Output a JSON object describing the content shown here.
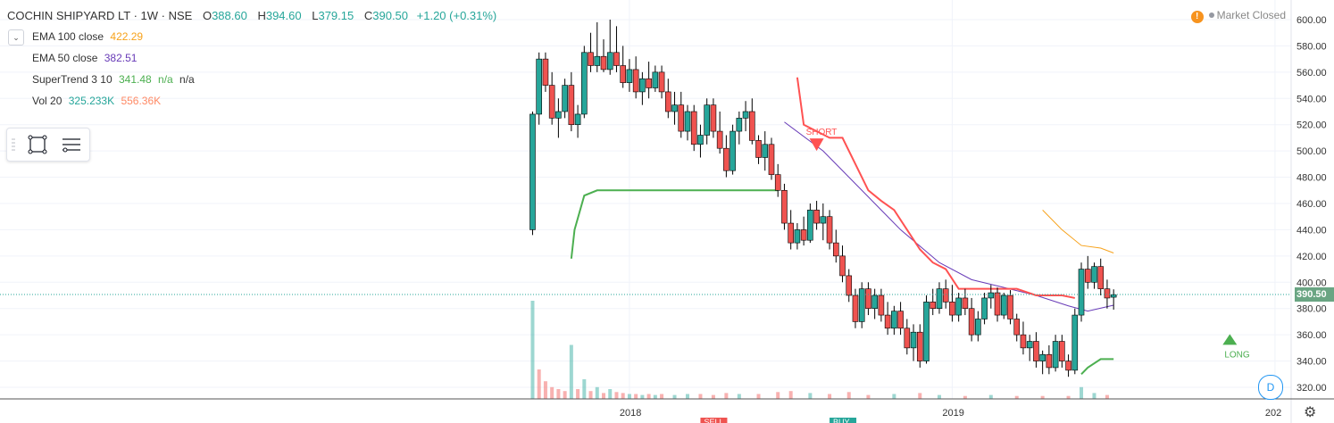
{
  "header": {
    "symbol_title": "COCHIN SHIPYARD LT · 1W · NSE",
    "open_label": "O",
    "open": "388.60",
    "high_label": "H",
    "high": "394.60",
    "low_label": "L",
    "low": "379.15",
    "close_label": "C",
    "close": "390.50",
    "change": "+1.20 (+0.31%)"
  },
  "indicators": [
    {
      "label": "EMA 100 close",
      "values": [
        "422.29"
      ],
      "colors": [
        "#f7a21b"
      ]
    },
    {
      "label": "EMA 50 close",
      "values": [
        "382.51"
      ],
      "colors": [
        "#673ab7"
      ]
    },
    {
      "label": "SuperTrend 3 10",
      "values": [
        "341.48",
        "n/a",
        "n/a"
      ],
      "colors": [
        "#4caf50",
        "#4caf50",
        "#333333"
      ]
    },
    {
      "label": "Vol 20",
      "values": [
        "325.233K",
        "556.36K"
      ],
      "colors": [
        "#26a69a",
        "#ff8a65"
      ]
    }
  ],
  "market_status": {
    "icon": "!",
    "text": "Market Closed"
  },
  "badge": {
    "label": "D"
  },
  "last_price_label": "390.50",
  "icons": {
    "collapse": "chevron-down-icon",
    "rectangle_tool": "rectangle-icon",
    "menu": "hamburger-icon",
    "settings": "gear-icon"
  },
  "colors": {
    "up": "#26a69a",
    "down": "#ef5350",
    "ema100": "#f7a21b",
    "ema50": "#673ab7",
    "supertrend_up": "#4caf50",
    "supertrend_down": "#ff5252",
    "last_price_line": "#26a69a"
  },
  "chart_data": {
    "type": "candlestick",
    "y_ticks": [
      "600.00",
      "580.00",
      "560.00",
      "540.00",
      "520.00",
      "500.00",
      "480.00",
      "460.00",
      "440.00",
      "420.00",
      "400.00",
      "380.00",
      "360.00",
      "340.00",
      "320.00"
    ],
    "ylim": [
      320,
      600
    ],
    "x_ticks": [
      "2018",
      "2019",
      "202"
    ],
    "x_tick_positions": [
      2018.0,
      2019.0,
      2020.0
    ],
    "xlim": [
      2016.05,
      2020.05
    ],
    "signals": [
      {
        "text": "SHORT",
        "x": 2018.58,
        "y": 515
      },
      {
        "text": "LONG",
        "x": 2019.86,
        "y": 351
      }
    ],
    "markers": [
      "BUY",
      "SELL"
    ],
    "candles": [
      {
        "t": 2017.7,
        "o": 440,
        "h": 530,
        "l": 436,
        "c": 528
      },
      {
        "t": 2017.72,
        "o": 528,
        "h": 575,
        "l": 520,
        "c": 570
      },
      {
        "t": 2017.74,
        "o": 570,
        "h": 575,
        "l": 545,
        "c": 550
      },
      {
        "t": 2017.76,
        "o": 550,
        "h": 560,
        "l": 520,
        "c": 525
      },
      {
        "t": 2017.78,
        "o": 525,
        "h": 540,
        "l": 510,
        "c": 530
      },
      {
        "t": 2017.8,
        "o": 530,
        "h": 555,
        "l": 525,
        "c": 550
      },
      {
        "t": 2017.82,
        "o": 550,
        "h": 560,
        "l": 515,
        "c": 520
      },
      {
        "t": 2017.84,
        "o": 520,
        "h": 535,
        "l": 510,
        "c": 528
      },
      {
        "t": 2017.86,
        "o": 528,
        "h": 580,
        "l": 525,
        "c": 575
      },
      {
        "t": 2017.88,
        "o": 575,
        "h": 590,
        "l": 560,
        "c": 565
      },
      {
        "t": 2017.9,
        "o": 565,
        "h": 598,
        "l": 560,
        "c": 572
      },
      {
        "t": 2017.92,
        "o": 572,
        "h": 585,
        "l": 560,
        "c": 562
      },
      {
        "t": 2017.94,
        "o": 562,
        "h": 600,
        "l": 558,
        "c": 575
      },
      {
        "t": 2017.96,
        "o": 575,
        "h": 595,
        "l": 560,
        "c": 565
      },
      {
        "t": 2017.98,
        "o": 565,
        "h": 580,
        "l": 548,
        "c": 552
      },
      {
        "t": 2018.0,
        "o": 552,
        "h": 570,
        "l": 545,
        "c": 562
      },
      {
        "t": 2018.02,
        "o": 562,
        "h": 572,
        "l": 540,
        "c": 545
      },
      {
        "t": 2018.04,
        "o": 545,
        "h": 560,
        "l": 535,
        "c": 555
      },
      {
        "t": 2018.06,
        "o": 555,
        "h": 568,
        "l": 540,
        "c": 548
      },
      {
        "t": 2018.08,
        "o": 548,
        "h": 565,
        "l": 545,
        "c": 560
      },
      {
        "t": 2018.1,
        "o": 560,
        "h": 565,
        "l": 540,
        "c": 545
      },
      {
        "t": 2018.12,
        "o": 545,
        "h": 555,
        "l": 525,
        "c": 530
      },
      {
        "t": 2018.14,
        "o": 530,
        "h": 545,
        "l": 520,
        "c": 535
      },
      {
        "t": 2018.16,
        "o": 535,
        "h": 545,
        "l": 510,
        "c": 515
      },
      {
        "t": 2018.18,
        "o": 515,
        "h": 535,
        "l": 508,
        "c": 530
      },
      {
        "t": 2018.2,
        "o": 530,
        "h": 535,
        "l": 500,
        "c": 505
      },
      {
        "t": 2018.22,
        "o": 505,
        "h": 520,
        "l": 495,
        "c": 512
      },
      {
        "t": 2018.24,
        "o": 512,
        "h": 540,
        "l": 505,
        "c": 535
      },
      {
        "t": 2018.26,
        "o": 535,
        "h": 540,
        "l": 510,
        "c": 515
      },
      {
        "t": 2018.28,
        "o": 515,
        "h": 530,
        "l": 498,
        "c": 502
      },
      {
        "t": 2018.3,
        "o": 502,
        "h": 512,
        "l": 480,
        "c": 485
      },
      {
        "t": 2018.32,
        "o": 485,
        "h": 520,
        "l": 482,
        "c": 515
      },
      {
        "t": 2018.34,
        "o": 515,
        "h": 530,
        "l": 505,
        "c": 525
      },
      {
        "t": 2018.36,
        "o": 525,
        "h": 538,
        "l": 515,
        "c": 530
      },
      {
        "t": 2018.38,
        "o": 530,
        "h": 540,
        "l": 505,
        "c": 508
      },
      {
        "t": 2018.4,
        "o": 508,
        "h": 512,
        "l": 490,
        "c": 495
      },
      {
        "t": 2018.42,
        "o": 495,
        "h": 515,
        "l": 485,
        "c": 505
      },
      {
        "t": 2018.44,
        "o": 505,
        "h": 510,
        "l": 478,
        "c": 482
      },
      {
        "t": 2018.46,
        "o": 482,
        "h": 490,
        "l": 465,
        "c": 470
      },
      {
        "t": 2018.48,
        "o": 470,
        "h": 475,
        "l": 440,
        "c": 445
      },
      {
        "t": 2018.5,
        "o": 445,
        "h": 455,
        "l": 425,
        "c": 430
      },
      {
        "t": 2018.52,
        "o": 430,
        "h": 445,
        "l": 425,
        "c": 440
      },
      {
        "t": 2018.54,
        "o": 440,
        "h": 450,
        "l": 428,
        "c": 432
      },
      {
        "t": 2018.56,
        "o": 432,
        "h": 460,
        "l": 430,
        "c": 455
      },
      {
        "t": 2018.58,
        "o": 455,
        "h": 462,
        "l": 440,
        "c": 445
      },
      {
        "t": 2018.6,
        "o": 445,
        "h": 460,
        "l": 432,
        "c": 450
      },
      {
        "t": 2018.62,
        "o": 450,
        "h": 455,
        "l": 425,
        "c": 430
      },
      {
        "t": 2018.64,
        "o": 430,
        "h": 440,
        "l": 415,
        "c": 420
      },
      {
        "t": 2018.66,
        "o": 420,
        "h": 428,
        "l": 400,
        "c": 405
      },
      {
        "t": 2018.68,
        "o": 405,
        "h": 410,
        "l": 385,
        "c": 390
      },
      {
        "t": 2018.7,
        "o": 390,
        "h": 395,
        "l": 365,
        "c": 370
      },
      {
        "t": 2018.72,
        "o": 370,
        "h": 400,
        "l": 365,
        "c": 395
      },
      {
        "t": 2018.74,
        "o": 395,
        "h": 400,
        "l": 375,
        "c": 380
      },
      {
        "t": 2018.76,
        "o": 380,
        "h": 395,
        "l": 372,
        "c": 390
      },
      {
        "t": 2018.78,
        "o": 390,
        "h": 395,
        "l": 370,
        "c": 375
      },
      {
        "t": 2018.8,
        "o": 375,
        "h": 385,
        "l": 360,
        "c": 365
      },
      {
        "t": 2018.82,
        "o": 365,
        "h": 382,
        "l": 360,
        "c": 378
      },
      {
        "t": 2018.84,
        "o": 378,
        "h": 385,
        "l": 360,
        "c": 365
      },
      {
        "t": 2018.86,
        "o": 365,
        "h": 372,
        "l": 345,
        "c": 350
      },
      {
        "t": 2018.88,
        "o": 350,
        "h": 368,
        "l": 340,
        "c": 362
      },
      {
        "t": 2018.9,
        "o": 362,
        "h": 368,
        "l": 335,
        "c": 340
      },
      {
        "t": 2018.92,
        "o": 340,
        "h": 390,
        "l": 338,
        "c": 385
      },
      {
        "t": 2018.94,
        "o": 385,
        "h": 395,
        "l": 375,
        "c": 380
      },
      {
        "t": 2018.96,
        "o": 380,
        "h": 400,
        "l": 376,
        "c": 395
      },
      {
        "t": 2018.98,
        "o": 395,
        "h": 402,
        "l": 380,
        "c": 385
      },
      {
        "t": 2019.0,
        "o": 385,
        "h": 398,
        "l": 370,
        "c": 375
      },
      {
        "t": 2019.02,
        "o": 375,
        "h": 392,
        "l": 370,
        "c": 388
      },
      {
        "t": 2019.04,
        "o": 388,
        "h": 395,
        "l": 375,
        "c": 380
      },
      {
        "t": 2019.06,
        "o": 380,
        "h": 388,
        "l": 355,
        "c": 360
      },
      {
        "t": 2019.08,
        "o": 360,
        "h": 378,
        "l": 355,
        "c": 372
      },
      {
        "t": 2019.1,
        "o": 372,
        "h": 392,
        "l": 368,
        "c": 388
      },
      {
        "t": 2019.12,
        "o": 388,
        "h": 398,
        "l": 380,
        "c": 392
      },
      {
        "t": 2019.14,
        "o": 392,
        "h": 396,
        "l": 370,
        "c": 375
      },
      {
        "t": 2019.16,
        "o": 375,
        "h": 392,
        "l": 372,
        "c": 390
      },
      {
        "t": 2019.18,
        "o": 390,
        "h": 394,
        "l": 368,
        "c": 372
      },
      {
        "t": 2019.2,
        "o": 372,
        "h": 376,
        "l": 355,
        "c": 360
      },
      {
        "t": 2019.22,
        "o": 360,
        "h": 370,
        "l": 345,
        "c": 350
      },
      {
        "t": 2019.24,
        "o": 350,
        "h": 360,
        "l": 340,
        "c": 355
      },
      {
        "t": 2019.26,
        "o": 355,
        "h": 362,
        "l": 335,
        "c": 340
      },
      {
        "t": 2019.28,
        "o": 340,
        "h": 348,
        "l": 330,
        "c": 345
      },
      {
        "t": 2019.3,
        "o": 345,
        "h": 352,
        "l": 330,
        "c": 335
      },
      {
        "t": 2019.32,
        "o": 335,
        "h": 360,
        "l": 332,
        "c": 355
      },
      {
        "t": 2019.34,
        "o": 355,
        "h": 360,
        "l": 335,
        "c": 340
      },
      {
        "t": 2019.36,
        "o": 340,
        "h": 345,
        "l": 328,
        "c": 333
      },
      {
        "t": 2019.38,
        "o": 333,
        "h": 380,
        "l": 330,
        "c": 375
      },
      {
        "t": 2019.4,
        "o": 375,
        "h": 415,
        "l": 370,
        "c": 410
      },
      {
        "t": 2019.42,
        "o": 410,
        "h": 420,
        "l": 395,
        "c": 400
      },
      {
        "t": 2019.44,
        "o": 400,
        "h": 415,
        "l": 395,
        "c": 412
      },
      {
        "t": 2019.46,
        "o": 412,
        "h": 418,
        "l": 390,
        "c": 395
      },
      {
        "t": 2019.48,
        "o": 395,
        "h": 402,
        "l": 380,
        "c": 388
      },
      {
        "t": 2019.5,
        "o": 388.6,
        "h": 394.6,
        "l": 379.15,
        "c": 390.5
      }
    ],
    "ema100": [
      [
        2019.28,
        455
      ],
      [
        2019.34,
        440
      ],
      [
        2019.4,
        428
      ],
      [
        2019.46,
        426
      ],
      [
        2019.5,
        422.29
      ]
    ],
    "ema50": [
      [
        2018.48,
        522
      ],
      [
        2018.6,
        500
      ],
      [
        2018.72,
        470
      ],
      [
        2018.84,
        440
      ],
      [
        2018.96,
        415
      ],
      [
        2019.06,
        402
      ],
      [
        2019.16,
        396
      ],
      [
        2019.26,
        390
      ],
      [
        2019.36,
        382
      ],
      [
        2019.42,
        378
      ],
      [
        2019.5,
        382.51
      ]
    ],
    "supertrend_up_1": [
      [
        2017.82,
        418
      ],
      [
        2017.83,
        440
      ],
      [
        2017.86,
        466
      ],
      [
        2017.9,
        470
      ],
      [
        2018.46,
        470
      ]
    ],
    "supertrend_down": [
      [
        2018.52,
        556
      ],
      [
        2018.54,
        520
      ],
      [
        2018.62,
        510
      ],
      [
        2018.66,
        510
      ],
      [
        2018.7,
        490
      ],
      [
        2018.74,
        470
      ],
      [
        2018.78,
        462
      ],
      [
        2018.82,
        455
      ],
      [
        2018.86,
        440
      ],
      [
        2018.9,
        425
      ],
      [
        2018.94,
        415
      ],
      [
        2018.98,
        410
      ],
      [
        2019.02,
        395
      ],
      [
        2019.1,
        395
      ],
      [
        2019.2,
        395
      ],
      [
        2019.26,
        390
      ],
      [
        2019.34,
        390
      ],
      [
        2019.38,
        388
      ]
    ],
    "supertrend_up_2": [
      [
        2019.4,
        330
      ],
      [
        2019.42,
        335
      ],
      [
        2019.46,
        341.48
      ],
      [
        2019.5,
        341.48
      ]
    ],
    "volume": [
      {
        "t": 2017.7,
        "v": 1.0,
        "up": true
      },
      {
        "t": 2017.72,
        "v": 0.3,
        "up": false
      },
      {
        "t": 2017.74,
        "v": 0.18,
        "up": false
      },
      {
        "t": 2017.76,
        "v": 0.12,
        "up": false
      },
      {
        "t": 2017.78,
        "v": 0.1,
        "up": false
      },
      {
        "t": 2017.8,
        "v": 0.08,
        "up": false
      },
      {
        "t": 2017.82,
        "v": 0.55,
        "up": true
      },
      {
        "t": 2017.84,
        "v": 0.1,
        "up": false
      },
      {
        "t": 2017.86,
        "v": 0.2,
        "up": true
      },
      {
        "t": 2017.88,
        "v": 0.08,
        "up": false
      },
      {
        "t": 2017.9,
        "v": 0.12,
        "up": true
      },
      {
        "t": 2017.92,
        "v": 0.06,
        "up": false
      },
      {
        "t": 2017.94,
        "v": 0.1,
        "up": true
      },
      {
        "t": 2017.96,
        "v": 0.07,
        "up": false
      },
      {
        "t": 2017.98,
        "v": 0.06,
        "up": false
      },
      {
        "t": 2018.0,
        "v": 0.05,
        "up": true
      },
      {
        "t": 2018.02,
        "v": 0.05,
        "up": false
      },
      {
        "t": 2018.04,
        "v": 0.04,
        "up": true
      },
      {
        "t": 2018.06,
        "v": 0.05,
        "up": false
      },
      {
        "t": 2018.08,
        "v": 0.04,
        "up": true
      },
      {
        "t": 2018.1,
        "v": 0.05,
        "up": false
      },
      {
        "t": 2018.14,
        "v": 0.04,
        "up": true
      },
      {
        "t": 2018.18,
        "v": 0.05,
        "up": true
      },
      {
        "t": 2018.22,
        "v": 0.05,
        "up": false
      },
      {
        "t": 2018.26,
        "v": 0.04,
        "up": false
      },
      {
        "t": 2018.3,
        "v": 0.06,
        "up": false
      },
      {
        "t": 2018.34,
        "v": 0.05,
        "up": true
      },
      {
        "t": 2018.4,
        "v": 0.05,
        "up": false
      },
      {
        "t": 2018.46,
        "v": 0.07,
        "up": false
      },
      {
        "t": 2018.5,
        "v": 0.08,
        "up": false
      },
      {
        "t": 2018.56,
        "v": 0.06,
        "up": true
      },
      {
        "t": 2018.62,
        "v": 0.05,
        "up": false
      },
      {
        "t": 2018.68,
        "v": 0.07,
        "up": false
      },
      {
        "t": 2018.74,
        "v": 0.04,
        "up": false
      },
      {
        "t": 2018.82,
        "v": 0.05,
        "up": true
      },
      {
        "t": 2018.9,
        "v": 0.06,
        "up": false
      },
      {
        "t": 2018.96,
        "v": 0.04,
        "up": true
      },
      {
        "t": 2019.04,
        "v": 0.03,
        "up": false
      },
      {
        "t": 2019.12,
        "v": 0.04,
        "up": true
      },
      {
        "t": 2019.2,
        "v": 0.03,
        "up": false
      },
      {
        "t": 2019.28,
        "v": 0.03,
        "up": false
      },
      {
        "t": 2019.36,
        "v": 0.03,
        "up": false
      },
      {
        "t": 2019.4,
        "v": 0.12,
        "up": true
      },
      {
        "t": 2019.44,
        "v": 0.06,
        "up": true
      },
      {
        "t": 2019.48,
        "v": 0.04,
        "up": false
      }
    ]
  }
}
